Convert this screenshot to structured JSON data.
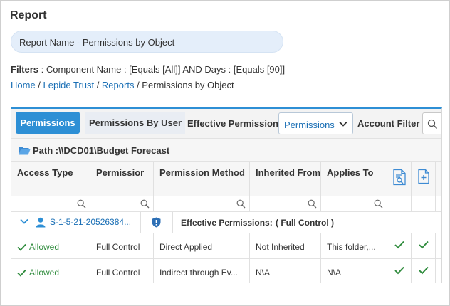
{
  "page": {
    "title": "Report",
    "report_name": "Report Name - Permissions by Object"
  },
  "filters": {
    "label": "Filters",
    "text": " : Component Name : [Equals [All]] AND Days : [Equals [90]]"
  },
  "breadcrumb": {
    "home": "Home",
    "sep1": " / ",
    "lepide": "Lepide Trust",
    "sep2": " / ",
    "reports": "Reports",
    "sep3": " / ",
    "current": "Permissions by Object"
  },
  "toolbar": {
    "tab_permissions": "Permissions",
    "tab_permissions_by_user": "Permissions By User",
    "effective_label": "Effective Permission :",
    "effective_value": "Permissions",
    "account_filter_label": "Account Filter :"
  },
  "path": {
    "text": "Path :\\\\DCD01\\Budget Forecast"
  },
  "table": {
    "columns": [
      {
        "label": "Access Type"
      },
      {
        "label": "Permissior"
      },
      {
        "label": "Permission Method"
      },
      {
        "label": "Inherited From"
      },
      {
        "label": "Applies To"
      }
    ],
    "group": {
      "sid": "S-1-5-21-20526384...",
      "effective_label": "Effective Permissions:",
      "effective_value": "( Full Control )"
    },
    "rows": [
      {
        "access_type": "Allowed",
        "permission": "Full Control",
        "method": "Direct Applied",
        "inherited_from": "Not Inherited",
        "applies_to": "This folder,..."
      },
      {
        "access_type": "Allowed",
        "permission": "Full Control",
        "method": "Indirect through Ev...",
        "inherited_from": "N\\A",
        "applies_to": "N\\A"
      }
    ]
  },
  "colors": {
    "accent": "#2d8fd5",
    "link": "#1a6fb5",
    "allowed": "#2e8b3c"
  }
}
